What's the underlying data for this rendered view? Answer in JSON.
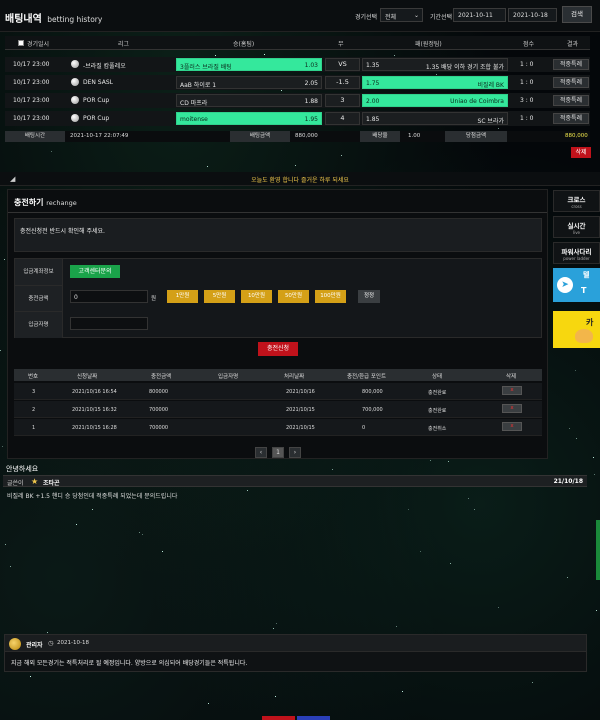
{
  "history": {
    "title": "배팅내역",
    "title_en": "betting history",
    "filter_game_label": "경기선택",
    "filter_game_value": "전체",
    "filter_period_label": "기간선택",
    "date_from": "2021-10-11",
    "date_sep": "~",
    "date_to": "2021-10-18",
    "search_label": "검색",
    "columns": [
      "경기일시",
      "리그",
      "승(홈팀)",
      "무",
      "패(원정팀)",
      "점수",
      "결과"
    ],
    "rows": [
      {
        "date": "10/17 23:00",
        "league": "-브라질 캄풀레오",
        "home": "3플러스 브라질 배팅",
        "home_odd": "1.03",
        "mid": "VS",
        "away": "1.35 배당 이하 경기 조합 불가",
        "away_odd": "1.35",
        "score": "1 : 0",
        "result": "적중특례",
        "home_sel": true,
        "away_sel": false
      },
      {
        "date": "10/17 23:00",
        "league": "DEN SASL",
        "home": "AaB 하이로 1",
        "home_odd": "2.05",
        "mid": "-1.5",
        "away": "비질레 BK",
        "away_odd": "1.75",
        "score": "1 : 0",
        "result": "적중특례",
        "home_sel": false,
        "away_sel": true
      },
      {
        "date": "10/17 23:00",
        "league": "POR Cup",
        "home": "CD 마프라",
        "home_odd": "1.88",
        "mid": "3",
        "away": "Uniao de Coimbra",
        "away_odd": "2.00",
        "score": "3 : 0",
        "result": "적중특례",
        "home_sel": false,
        "away_sel": true
      },
      {
        "date": "10/17 23:00",
        "league": "POR Cup",
        "home": "moitense",
        "home_odd": "1.95",
        "mid": "4",
        "away": "SC 브라가",
        "away_odd": "1.85",
        "score": "1 : 0",
        "result": "적중특례",
        "home_sel": true,
        "away_sel": false
      }
    ],
    "summary": {
      "bet_time_label": "배팅시간",
      "bet_time": "2021-10-17 22:07:49",
      "bet_amount_label": "배팅금액",
      "bet_amount": "880,000",
      "rate_label": "배당율",
      "rate": "1.00",
      "win_amount_label": "당첨금액",
      "win_amount": "880,000"
    },
    "delete_label": "삭제"
  },
  "notice": {
    "text": "오늘도 환영 합니다 즐거운 하루 되세요"
  },
  "charge": {
    "title": "충전하기",
    "title_en": "rechange",
    "notice": "충전신청전 반드시 확인해 주세요.",
    "deposit_account_label": "입금계좌정보",
    "center_btn": "고객센터문의",
    "amount_label": "충전금액",
    "amount_value": "0",
    "won": "원",
    "amount_buttons": [
      "1만원",
      "5만원",
      "10만원",
      "50만원",
      "100만원"
    ],
    "reset_label": "정정",
    "depositor_label": "입금자명",
    "apply_label": "충전신청",
    "history_cols": [
      "번호",
      "신청날짜",
      "충전금액",
      "입금자명",
      "처리날짜",
      "충전/환급 포인트",
      "상태",
      "삭제"
    ],
    "history_rows": [
      {
        "no": "3",
        "req": "2021/10/16 16:54",
        "amount": "800000",
        "name": "",
        "proc": "2021/10/16",
        "point": "800,000",
        "status": "충전완료"
      },
      {
        "no": "2",
        "req": "2021/10/15 16:32",
        "amount": "700000",
        "name": "",
        "proc": "2021/10/15",
        "point": "700,000",
        "status": "충전완료"
      },
      {
        "no": "1",
        "req": "2021/10/15 16:28",
        "amount": "700000",
        "name": "",
        "proc": "2021/10/15",
        "point": "0",
        "status": "충전취소"
      }
    ],
    "delete_x": "x",
    "page_prev": "‹",
    "page_current": "1",
    "page_next": "›"
  },
  "sidebar": {
    "items": [
      {
        "title": "크로스",
        "sub": "cross"
      },
      {
        "title": "실시간",
        "sub": "live"
      },
      {
        "title": "파워사다리",
        "sub": "power ladder"
      }
    ],
    "telegram_t1": "텔",
    "telegram_t2": "T",
    "kakao_t1": "카"
  },
  "post": {
    "title": "안녕하세요",
    "writer_label": "글쓴이",
    "author": "조타곤",
    "date": "21/10/18",
    "body": "비질레 BK +1.5 핸디 승 당첨인데 적중특례 되었는데 문의드립니다"
  },
  "comment": {
    "author": "관리자",
    "date": "2021-10-18",
    "body": "지금 해외 모든경기는 적특처리로 될 예정입니다. 양방으로 의심되어 배당경기들은 적특됩니다."
  },
  "colors": {
    "accent_green": "#34e89c",
    "danger": "#c0121b",
    "gold": "#d4a017",
    "warning_text": "#f2c94c"
  }
}
